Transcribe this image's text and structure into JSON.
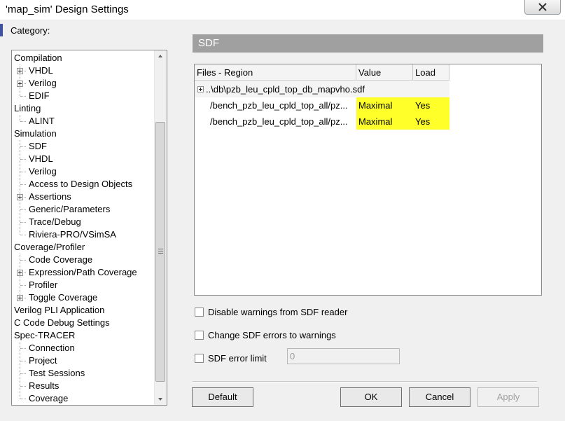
{
  "window": {
    "title": "'map_sim' Design Settings"
  },
  "category_label": "Category:",
  "tree": [
    {
      "label": "Compilation",
      "level": 0,
      "expandable": false
    },
    {
      "label": "VHDL",
      "level": 1,
      "expandable": true
    },
    {
      "label": "Verilog",
      "level": 1,
      "expandable": true
    },
    {
      "label": "EDIF",
      "level": 1,
      "expandable": false
    },
    {
      "label": "Linting",
      "level": 0,
      "expandable": false
    },
    {
      "label": "ALINT",
      "level": 1,
      "expandable": false
    },
    {
      "label": "Simulation",
      "level": 0,
      "expandable": false
    },
    {
      "label": "SDF",
      "level": 1,
      "expandable": false
    },
    {
      "label": "VHDL",
      "level": 1,
      "expandable": false
    },
    {
      "label": "Verilog",
      "level": 1,
      "expandable": false
    },
    {
      "label": "Access to Design Objects",
      "level": 1,
      "expandable": false
    },
    {
      "label": "Assertions",
      "level": 1,
      "expandable": true
    },
    {
      "label": "Generic/Parameters",
      "level": 1,
      "expandable": false
    },
    {
      "label": "Trace/Debug",
      "level": 1,
      "expandable": false
    },
    {
      "label": "Riviera-PRO/VSimSA",
      "level": 1,
      "expandable": false
    },
    {
      "label": "Coverage/Profiler",
      "level": 0,
      "expandable": false
    },
    {
      "label": "Code Coverage",
      "level": 1,
      "expandable": false
    },
    {
      "label": "Expression/Path Coverage",
      "level": 1,
      "expandable": true
    },
    {
      "label": "Profiler",
      "level": 1,
      "expandable": false
    },
    {
      "label": "Toggle Coverage",
      "level": 1,
      "expandable": true
    },
    {
      "label": "Verilog PLI Application",
      "level": 0,
      "expandable": false
    },
    {
      "label": "C Code Debug Settings",
      "level": 0,
      "expandable": false
    },
    {
      "label": "Spec-TRACER",
      "level": 0,
      "expandable": false
    },
    {
      "label": "Connection",
      "level": 1,
      "expandable": false
    },
    {
      "label": "Project",
      "level": 1,
      "expandable": false
    },
    {
      "label": "Test Sessions",
      "level": 1,
      "expandable": false
    },
    {
      "label": "Results",
      "level": 1,
      "expandable": false
    },
    {
      "label": "Coverage",
      "level": 1,
      "expandable": false
    }
  ],
  "panel": {
    "title": "SDF",
    "columns": [
      "Files - Region",
      "Value",
      "Load"
    ],
    "file_node": "..\\db\\pzb_leu_cpld_top_db_mapvho.sdf",
    "rows": [
      {
        "region": "/bench_pzb_leu_cpld_top_all/pz...",
        "value": "Maximal",
        "load": "Yes"
      },
      {
        "region": "/bench_pzb_leu_cpld_top_all/pz...",
        "value": "Maximal",
        "load": "Yes"
      }
    ],
    "highlight_color": "#ffff2a"
  },
  "options": {
    "disable_warnings": "Disable warnings from SDF reader",
    "change_errors": "Change SDF errors to warnings",
    "error_limit": "SDF error limit",
    "error_limit_value": "0"
  },
  "buttons": {
    "default": "Default",
    "ok": "OK",
    "cancel": "Cancel",
    "apply": "Apply"
  }
}
